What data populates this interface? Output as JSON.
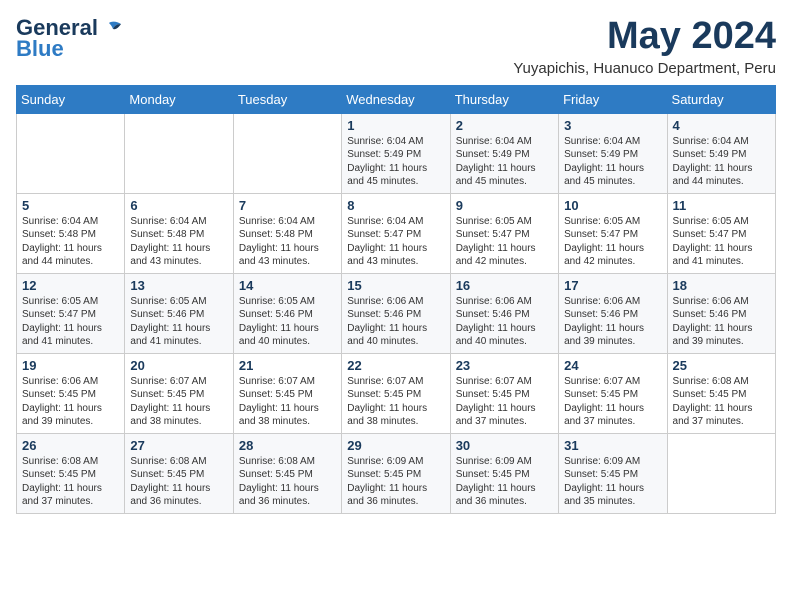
{
  "header": {
    "logo_line1": "General",
    "logo_line2": "Blue",
    "month_title": "May 2024",
    "location": "Yuyapichis, Huanuco Department, Peru"
  },
  "calendar": {
    "weekdays": [
      "Sunday",
      "Monday",
      "Tuesday",
      "Wednesday",
      "Thursday",
      "Friday",
      "Saturday"
    ],
    "weeks": [
      [
        {
          "day": "",
          "info": ""
        },
        {
          "day": "",
          "info": ""
        },
        {
          "day": "",
          "info": ""
        },
        {
          "day": "1",
          "info": "Sunrise: 6:04 AM\nSunset: 5:49 PM\nDaylight: 11 hours and 45 minutes."
        },
        {
          "day": "2",
          "info": "Sunrise: 6:04 AM\nSunset: 5:49 PM\nDaylight: 11 hours and 45 minutes."
        },
        {
          "day": "3",
          "info": "Sunrise: 6:04 AM\nSunset: 5:49 PM\nDaylight: 11 hours and 45 minutes."
        },
        {
          "day": "4",
          "info": "Sunrise: 6:04 AM\nSunset: 5:49 PM\nDaylight: 11 hours and 44 minutes."
        }
      ],
      [
        {
          "day": "5",
          "info": "Sunrise: 6:04 AM\nSunset: 5:48 PM\nDaylight: 11 hours and 44 minutes."
        },
        {
          "day": "6",
          "info": "Sunrise: 6:04 AM\nSunset: 5:48 PM\nDaylight: 11 hours and 43 minutes."
        },
        {
          "day": "7",
          "info": "Sunrise: 6:04 AM\nSunset: 5:48 PM\nDaylight: 11 hours and 43 minutes."
        },
        {
          "day": "8",
          "info": "Sunrise: 6:04 AM\nSunset: 5:47 PM\nDaylight: 11 hours and 43 minutes."
        },
        {
          "day": "9",
          "info": "Sunrise: 6:05 AM\nSunset: 5:47 PM\nDaylight: 11 hours and 42 minutes."
        },
        {
          "day": "10",
          "info": "Sunrise: 6:05 AM\nSunset: 5:47 PM\nDaylight: 11 hours and 42 minutes."
        },
        {
          "day": "11",
          "info": "Sunrise: 6:05 AM\nSunset: 5:47 PM\nDaylight: 11 hours and 41 minutes."
        }
      ],
      [
        {
          "day": "12",
          "info": "Sunrise: 6:05 AM\nSunset: 5:47 PM\nDaylight: 11 hours and 41 minutes."
        },
        {
          "day": "13",
          "info": "Sunrise: 6:05 AM\nSunset: 5:46 PM\nDaylight: 11 hours and 41 minutes."
        },
        {
          "day": "14",
          "info": "Sunrise: 6:05 AM\nSunset: 5:46 PM\nDaylight: 11 hours and 40 minutes."
        },
        {
          "day": "15",
          "info": "Sunrise: 6:06 AM\nSunset: 5:46 PM\nDaylight: 11 hours and 40 minutes."
        },
        {
          "day": "16",
          "info": "Sunrise: 6:06 AM\nSunset: 5:46 PM\nDaylight: 11 hours and 40 minutes."
        },
        {
          "day": "17",
          "info": "Sunrise: 6:06 AM\nSunset: 5:46 PM\nDaylight: 11 hours and 39 minutes."
        },
        {
          "day": "18",
          "info": "Sunrise: 6:06 AM\nSunset: 5:46 PM\nDaylight: 11 hours and 39 minutes."
        }
      ],
      [
        {
          "day": "19",
          "info": "Sunrise: 6:06 AM\nSunset: 5:45 PM\nDaylight: 11 hours and 39 minutes."
        },
        {
          "day": "20",
          "info": "Sunrise: 6:07 AM\nSunset: 5:45 PM\nDaylight: 11 hours and 38 minutes."
        },
        {
          "day": "21",
          "info": "Sunrise: 6:07 AM\nSunset: 5:45 PM\nDaylight: 11 hours and 38 minutes."
        },
        {
          "day": "22",
          "info": "Sunrise: 6:07 AM\nSunset: 5:45 PM\nDaylight: 11 hours and 38 minutes."
        },
        {
          "day": "23",
          "info": "Sunrise: 6:07 AM\nSunset: 5:45 PM\nDaylight: 11 hours and 37 minutes."
        },
        {
          "day": "24",
          "info": "Sunrise: 6:07 AM\nSunset: 5:45 PM\nDaylight: 11 hours and 37 minutes."
        },
        {
          "day": "25",
          "info": "Sunrise: 6:08 AM\nSunset: 5:45 PM\nDaylight: 11 hours and 37 minutes."
        }
      ],
      [
        {
          "day": "26",
          "info": "Sunrise: 6:08 AM\nSunset: 5:45 PM\nDaylight: 11 hours and 37 minutes."
        },
        {
          "day": "27",
          "info": "Sunrise: 6:08 AM\nSunset: 5:45 PM\nDaylight: 11 hours and 36 minutes."
        },
        {
          "day": "28",
          "info": "Sunrise: 6:08 AM\nSunset: 5:45 PM\nDaylight: 11 hours and 36 minutes."
        },
        {
          "day": "29",
          "info": "Sunrise: 6:09 AM\nSunset: 5:45 PM\nDaylight: 11 hours and 36 minutes."
        },
        {
          "day": "30",
          "info": "Sunrise: 6:09 AM\nSunset: 5:45 PM\nDaylight: 11 hours and 36 minutes."
        },
        {
          "day": "31",
          "info": "Sunrise: 6:09 AM\nSunset: 5:45 PM\nDaylight: 11 hours and 35 minutes."
        },
        {
          "day": "",
          "info": ""
        }
      ]
    ]
  }
}
